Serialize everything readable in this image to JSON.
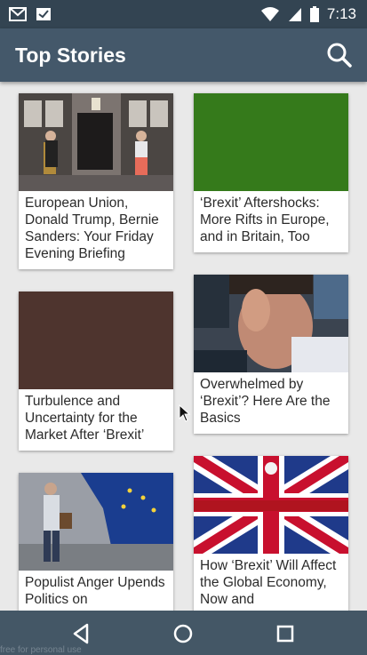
{
  "status_bar": {
    "time": "7:13",
    "left_icons": [
      "gmail-icon",
      "inbox-icon"
    ],
    "right_icons": [
      "wifi-icon",
      "signal-icon",
      "battery-icon"
    ]
  },
  "app_bar": {
    "title": "Top Stories",
    "search_icon": "search-icon"
  },
  "stories": [
    {
      "title": "European Union, Donald Trump, Bernie Sanders: Your Friday Evening Briefing",
      "image": "photo-downing-street",
      "image_color": "#6b6b6b"
    },
    {
      "title": "‘Brexit’ Aftershocks: More Rifts in Europe, and in Britain, Too",
      "image": "placeholder-green",
      "image_color": "#357a1b"
    },
    {
      "title": "Turbulence and Uncertainty for the Market After ‘Brexit’",
      "image": "placeholder-brown",
      "image_color": "#4e342e"
    },
    {
      "title": "Overwhelmed by ‘Brexit’? Here Are the Basics",
      "image": "photo-trader-head-in-hand",
      "image_color": "#5a6470"
    },
    {
      "title": "Populist Anger Upends Politics on",
      "image": "photo-eu-flag-man",
      "image_color": "#8a8d96"
    },
    {
      "title": "How ‘Brexit’ Will Affect the Global Economy, Now and",
      "image": "photo-union-jack-keep-calm",
      "image_color": "#1f3a8a"
    }
  ],
  "nav_bar": {
    "buttons": [
      "back-icon",
      "home-icon",
      "recents-icon"
    ],
    "watermark": "free for personal use"
  }
}
